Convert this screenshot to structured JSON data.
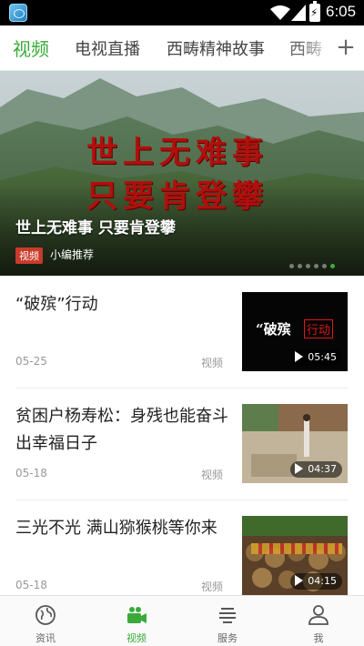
{
  "status_bar": {
    "time": "6:05"
  },
  "tabs": [
    {
      "label": "视频",
      "active": true
    },
    {
      "label": "电视直播",
      "active": false
    },
    {
      "label": "西畴精神故事",
      "active": false
    },
    {
      "label": "西畴",
      "active": false
    }
  ],
  "tab_add_icon": "plus-icon",
  "banner": {
    "calligraphy_line1": "世上无难事",
    "calligraphy_line2": "只要肯登攀",
    "title": "世上无难事 只要肯登攀",
    "tag": "视频",
    "subtitle": "小编推荐",
    "dots_total": 6,
    "dots_active_index": 5
  },
  "news": [
    {
      "title": "“破殡”行动",
      "date": "05-25",
      "type": "视频",
      "duration": "05:45",
      "thumb_text_1": "“破殡",
      "thumb_text_2": "行动"
    },
    {
      "title": "贫困户杨寿松：身残也能奋斗出幸福日子",
      "date": "05-18",
      "type": "视频",
      "duration": "04:37"
    },
    {
      "title": "三光不光 满山猕猴桃等你来",
      "date": "05-18",
      "type": "视频",
      "duration": "04:15"
    }
  ],
  "bottom_nav": [
    {
      "label": "资讯",
      "icon": "globe-icon",
      "active": false
    },
    {
      "label": "视频",
      "icon": "video-camera-icon",
      "active": true
    },
    {
      "label": "服务",
      "icon": "list-icon",
      "active": false
    },
    {
      "label": "我",
      "icon": "person-icon",
      "active": false
    }
  ],
  "colors": {
    "accent": "#3aab3a",
    "tag_red": "#c93a2a",
    "calligraphy_red": "#b0100d"
  }
}
